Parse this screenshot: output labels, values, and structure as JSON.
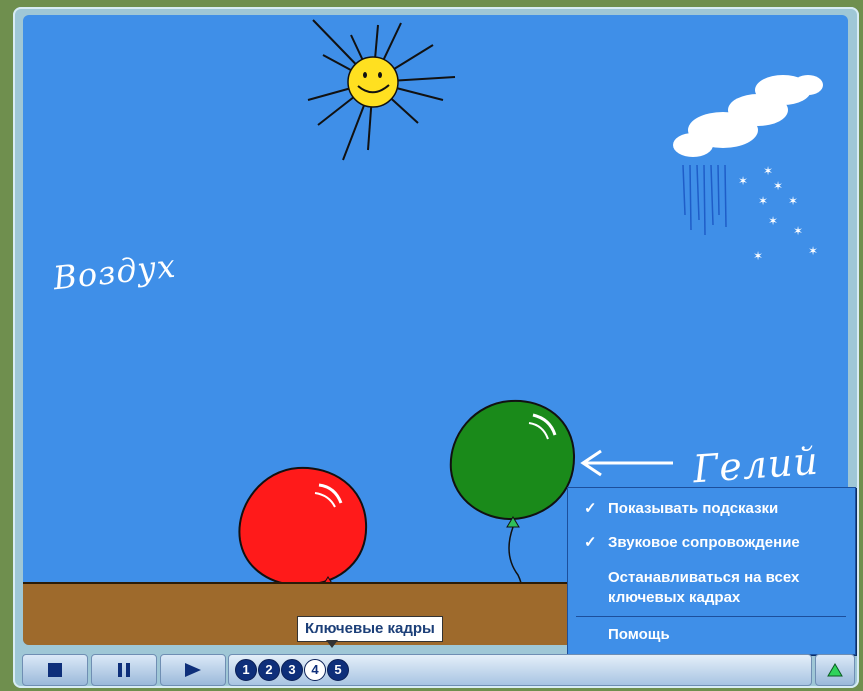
{
  "scene": {
    "label_air": "Воздух",
    "label_helium": "Гелий"
  },
  "menu": {
    "items": [
      {
        "label": "Показывать подсказки",
        "checked": true
      },
      {
        "label": "Звуковое сопровождение",
        "checked": true
      },
      {
        "label": "Останавливаться на всех ключевых кадрах",
        "checked": false
      },
      {
        "label": "Помощь",
        "checked": false
      }
    ],
    "check_mark": "✓"
  },
  "tooltip": {
    "text": "Ключевые кадры"
  },
  "controls": {
    "stop_icon": "stop-icon",
    "pause_icon": "pause-icon",
    "play_icon": "play-icon",
    "menu_toggle_icon": "triangle-up-icon"
  },
  "keyframes": {
    "items": [
      "1",
      "2",
      "3",
      "4",
      "5"
    ],
    "active": "4"
  },
  "colors": {
    "sky": "#3f8fe8",
    "ground": "#9e6a2c",
    "balloon_red": "#ff1a1a",
    "balloon_green": "#1a8a1a",
    "sun": "#ffe020",
    "control_dark": "#0e2f7a",
    "toggle_green": "#2fd35a"
  }
}
